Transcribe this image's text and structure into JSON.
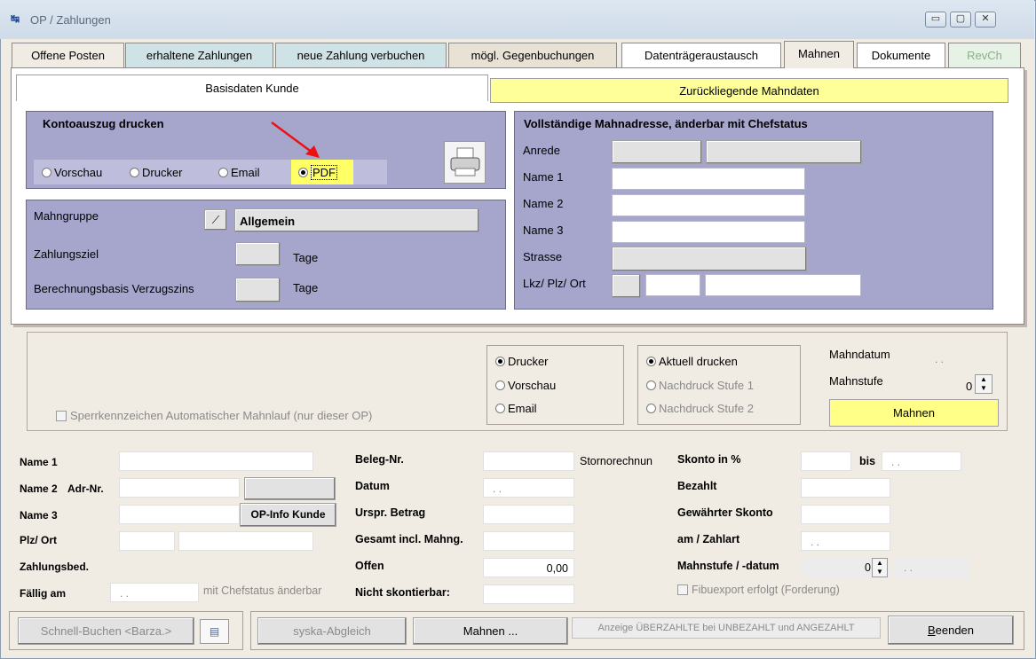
{
  "window": {
    "title": "OP / Zahlungen"
  },
  "tabs": [
    {
      "label": "Offene Posten",
      "bg": "#f0ebe3"
    },
    {
      "label": "erhaltene Zahlungen",
      "bg": "#cfe3e6"
    },
    {
      "label": "neue Zahlung verbuchen",
      "bg": "#cfe3e6"
    },
    {
      "label": "mögl. Gegenbuchungen",
      "bg": "#e8e2d5"
    },
    {
      "label": "Datenträgeraustausch",
      "bg": "#ffffff"
    },
    {
      "label": "Mahnen",
      "bg": "#f0ebe3"
    },
    {
      "label": "Dokumente",
      "bg": "#ffffff"
    },
    {
      "label": "RevCh",
      "bg": "#e6f2e6"
    }
  ],
  "subtabs": {
    "basis": "Basisdaten Kunde",
    "zurueck": "Zurückliegende Mahndaten"
  },
  "kontoauszug": {
    "title": "Kontoauszug drucken",
    "options": [
      "Vorschau",
      "Drucker",
      "Email",
      "PDF"
    ],
    "selected": "PDF"
  },
  "mahngruppe": {
    "label": "Mahngruppe",
    "value": "Allgemein",
    "zahlungsziel_label": "Zahlungsziel",
    "tage1": "Tage",
    "basis_label": "Berechnungsbasis Verzugszins",
    "tage2": "Tage"
  },
  "adresse": {
    "title": "Vollständige Mahnadresse, änderbar mit Chefstatus",
    "labels": [
      "Anrede",
      "Name 1",
      "Name 2",
      "Name 3",
      "Strasse",
      "Lkz/ Plz/ Ort"
    ]
  },
  "mahnlauf": {
    "sperr_label": "Sperrkennzeichen Automatischer Mahnlauf (nur dieser OP)",
    "output": [
      "Drucker",
      "Vorschau",
      "Email"
    ],
    "druck": [
      "Aktuell drucken",
      "Nachdruck Stufe 1",
      "Nachdruck Stufe 2"
    ],
    "mahndatum_label": "Mahndatum",
    "mahndatum_value": ". .",
    "mahnstufe_label": "Mahnstufe",
    "mahnstufe_value": "0",
    "mahnen_button": "Mahnen"
  },
  "bottom": {
    "name1": "Name 1",
    "name2": "Name 2",
    "adrnr": "Adr-Nr.",
    "name3": "Name 3",
    "plzort": "Plz/ Ort",
    "zahlungsbed": "Zahlungsbed.",
    "faellig": "Fällig am",
    "faellig_value": ". .",
    "chef": "mit Chefstatus änderbar",
    "opinfo": "OP-Info Kunde",
    "beleg": "Beleg-Nr.",
    "datum": "Datum",
    "datum_value": ". .",
    "urspr": "Urspr. Betrag",
    "gesamt": "Gesamt incl. Mahng.",
    "offen": "Offen",
    "offen_value": "0,00",
    "nicht": "Nicht skontierbar:",
    "storno": "Stornorechnun",
    "skonto": "Skonto in %",
    "bis": "bis",
    "bis_value": ". .",
    "bezahlt": "Bezahlt",
    "gewaehrt": "Gewährter Skonto",
    "am": "am / Zahlart",
    "am_value": ". .",
    "mahnstufe": "Mahnstufe / -datum",
    "mahnstufe_value": "0",
    "mahnstufe_date": ". .",
    "fibu": "Fibuexport erfolgt (Forderung)"
  },
  "footer": {
    "schnell": "Schnell-Buchen <Barza.>",
    "syska": "syska-Abgleich",
    "mahnen": "Mahnen ...",
    "anzeige": "Anzeige ÜBERZAHLTE bei UNBEZAHLT und ANGEZAHLT",
    "beenden": "Beenden"
  }
}
